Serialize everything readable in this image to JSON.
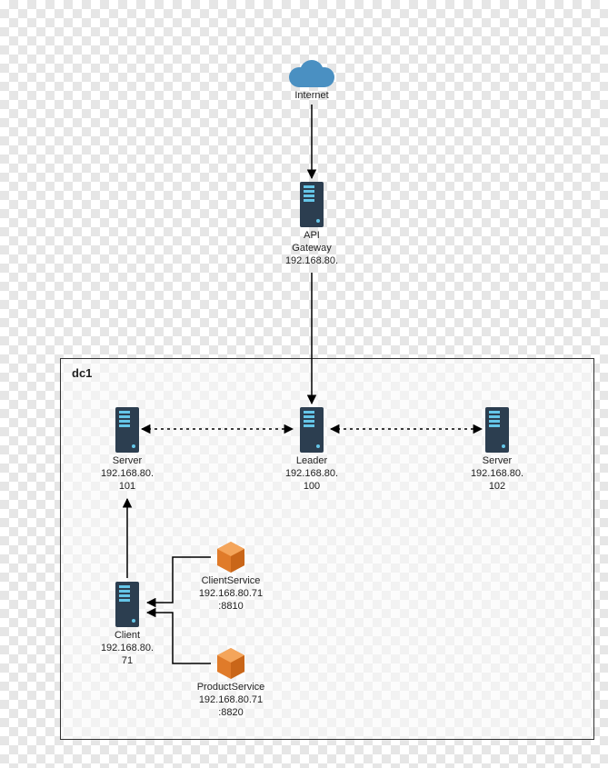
{
  "dc": {
    "title": "dc1"
  },
  "internet": {
    "label": "Internet"
  },
  "gateway": {
    "label1": "API",
    "label2": "Gateway",
    "label3": "192.168.80."
  },
  "leader": {
    "label1": "Leader",
    "label2": "192.168.80.",
    "label3": "100"
  },
  "server_left": {
    "label1": "Server",
    "label2": "192.168.80.",
    "label3": "101"
  },
  "server_right": {
    "label1": "Server",
    "label2": "192.168.80.",
    "label3": "102"
  },
  "client": {
    "label1": "Client",
    "label2": "192.168.80.",
    "label3": "71"
  },
  "client_service": {
    "label1": "ClientService",
    "label2": "192.168.80.71",
    "label3": ":8810"
  },
  "product_service": {
    "label1": "ProductService",
    "label2": "192.168.80.71",
    "label3": ":8820"
  }
}
